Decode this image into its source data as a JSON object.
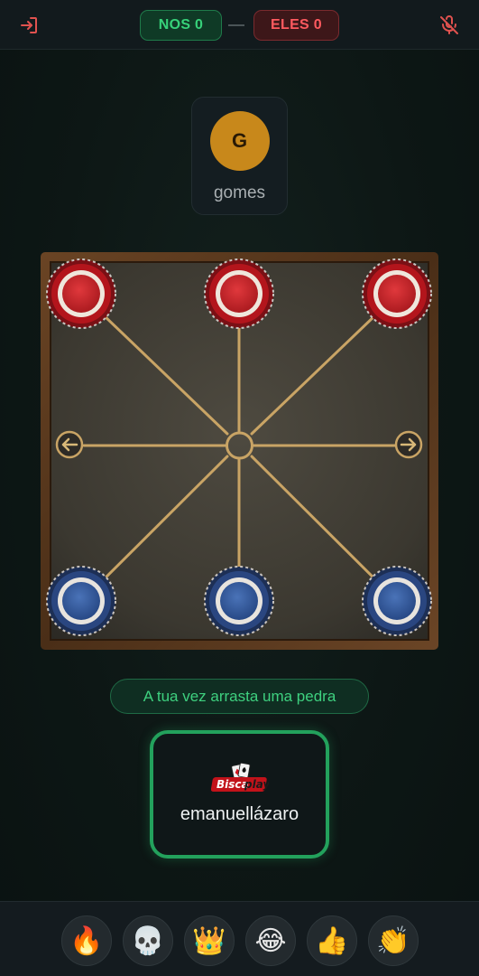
{
  "header": {
    "score_us": "NOS 0",
    "score_them": "ELES 0",
    "exit_icon": "exit-icon",
    "mic_icon": "mic-muted-icon"
  },
  "opponent": {
    "initial": "G",
    "name": "gomes",
    "avatar_color": "#c8881b"
  },
  "board": {
    "top_pieces_color": "red",
    "bottom_pieces_color": "blue",
    "pieces_top": [
      "top-left",
      "top-center",
      "top-right"
    ],
    "pieces_bottom": [
      "bottom-left",
      "bottom-center",
      "bottom-right"
    ],
    "arrows": [
      "left-arrow-icon",
      "right-arrow-icon"
    ]
  },
  "status": {
    "text": "A tua vez arrasta uma pedra"
  },
  "player": {
    "logo_text": "Biscaplay",
    "name": "emanuellázaro",
    "border_color": "#23a15c"
  },
  "reactions": [
    {
      "name": "fire",
      "glyph": "🔥"
    },
    {
      "name": "skull",
      "glyph": "💀"
    },
    {
      "name": "crown",
      "glyph": "👑"
    },
    {
      "name": "laughing",
      "glyph": "😂"
    },
    {
      "name": "thumbs-up",
      "glyph": "👍"
    },
    {
      "name": "clapping",
      "glyph": "👏"
    }
  ]
}
